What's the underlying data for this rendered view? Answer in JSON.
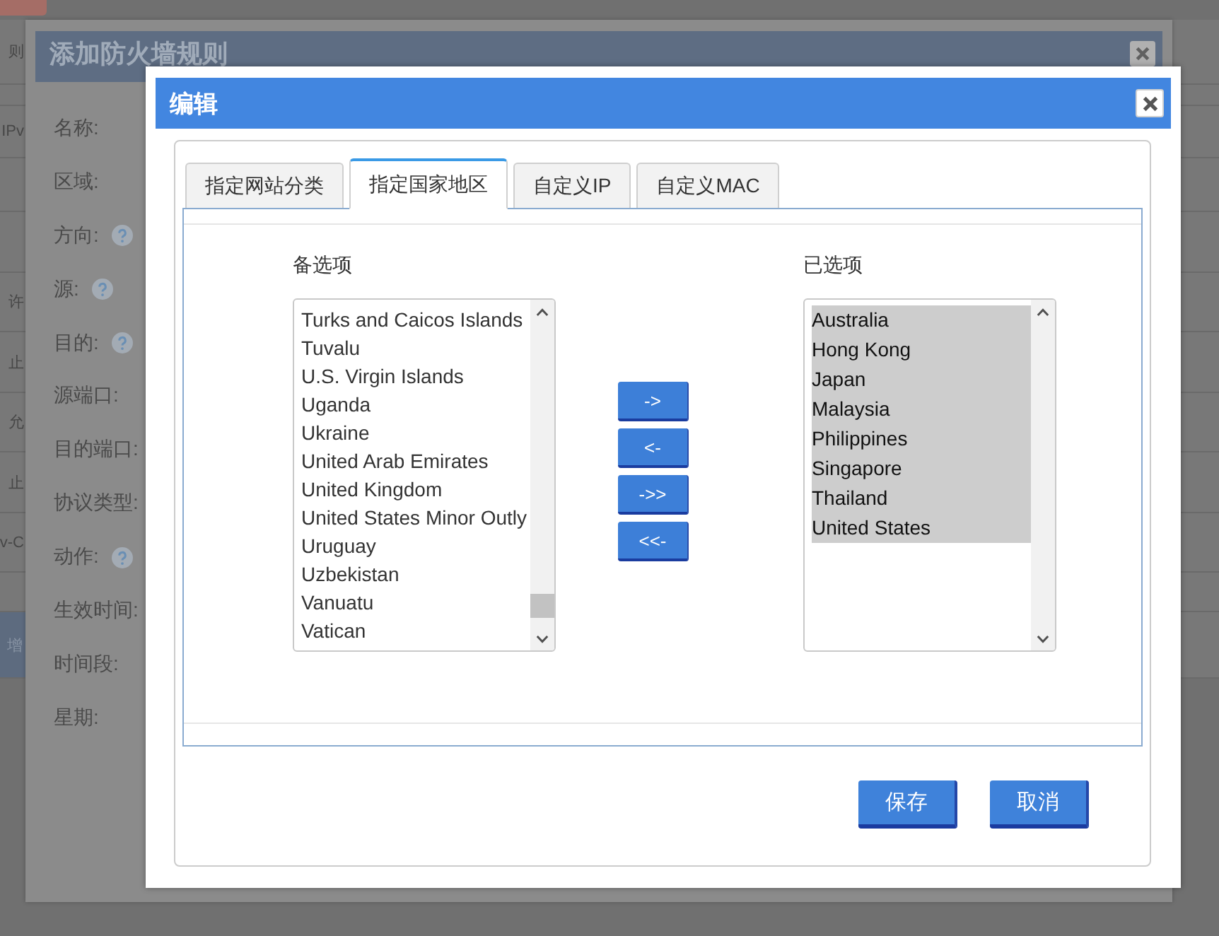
{
  "page": {
    "fragments": [
      "则",
      "IPv",
      "许",
      "止",
      "允",
      "止",
      "v-C"
    ],
    "add_button": "增"
  },
  "back_dialog": {
    "title": "添加防火墙规则",
    "fields": [
      {
        "label": "名称:",
        "help": false
      },
      {
        "label": "区域:",
        "help": false
      },
      {
        "label": "方向:",
        "help": true
      },
      {
        "label": "源:",
        "help": true
      },
      {
        "label": "目的:",
        "help": true
      },
      {
        "label": "源端口:",
        "help": false
      },
      {
        "label": "目的端口:",
        "help": false
      },
      {
        "label": "协议类型:",
        "help": false
      },
      {
        "label": "动作:",
        "help": true
      },
      {
        "label": "生效时间:",
        "help": false
      },
      {
        "label": "时间段:",
        "help": false
      },
      {
        "label": "星期:",
        "help": false
      }
    ]
  },
  "dialog": {
    "title": "编辑",
    "tabs": [
      {
        "label": "指定网站分类",
        "selected": false
      },
      {
        "label": "指定国家地区",
        "selected": true
      },
      {
        "label": "自定义IP",
        "selected": false
      },
      {
        "label": "自定义MAC",
        "selected": false
      }
    ],
    "available": {
      "label": "备选项",
      "options": [
        {
          "text": "Turks and Caicos Islands",
          "selected": false
        },
        {
          "text": "Tuvalu",
          "selected": false
        },
        {
          "text": "U.S. Virgin Islands",
          "selected": false
        },
        {
          "text": "Uganda",
          "selected": false
        },
        {
          "text": "Ukraine",
          "selected": false
        },
        {
          "text": "United Arab Emirates",
          "selected": false
        },
        {
          "text": "United Kingdom",
          "selected": false
        },
        {
          "text": "United States Minor Outly",
          "selected": false
        },
        {
          "text": "Uruguay",
          "selected": false
        },
        {
          "text": "Uzbekistan",
          "selected": false
        },
        {
          "text": "Vanuatu",
          "selected": false
        },
        {
          "text": "Vatican",
          "selected": false
        }
      ]
    },
    "move_buttons": [
      "->",
      "<-",
      "->>",
      "<<-"
    ],
    "chosen": {
      "label": "已选项",
      "options": [
        {
          "text": "Australia",
          "selected": true
        },
        {
          "text": "Hong Kong",
          "selected": true
        },
        {
          "text": "Japan",
          "selected": true
        },
        {
          "text": "Malaysia",
          "selected": true
        },
        {
          "text": "Philippines",
          "selected": true
        },
        {
          "text": "Singapore",
          "selected": true
        },
        {
          "text": "Thailand",
          "selected": true
        },
        {
          "text": "United States",
          "selected": true
        }
      ]
    },
    "buttons": [
      "保存",
      "取消"
    ]
  }
}
